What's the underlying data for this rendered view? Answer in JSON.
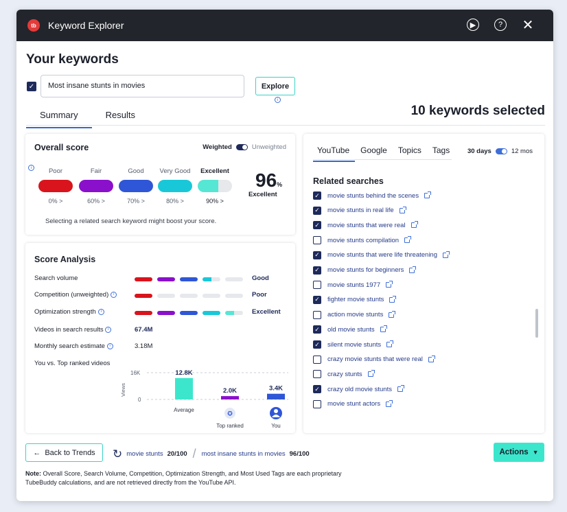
{
  "window": {
    "title": "Keyword Explorer",
    "logo_text": "tb"
  },
  "heading": "Your keywords",
  "keyword_input": {
    "value": "Most insane stunts in movies",
    "checked": true
  },
  "explore_label": "Explore",
  "tabs": [
    {
      "label": "Summary",
      "active": true
    },
    {
      "label": "Results",
      "active": false
    }
  ],
  "keywords_selected": "10 keywords selected",
  "overall": {
    "title": "Overall score",
    "toggle_left": "Weighted",
    "toggle_right": "Unweighted",
    "levels": [
      {
        "label": "Poor",
        "sub": "0% >",
        "color": "#d9141c",
        "fill": 1.0
      },
      {
        "label": "Fair",
        "sub": "60% >",
        "color": "#8a10cc",
        "fill": 1.0
      },
      {
        "label": "Good",
        "sub": "70% >",
        "color": "#2f56d6",
        "fill": 1.0
      },
      {
        "label": "Very Good",
        "sub": "80% >",
        "color": "#18c8d8",
        "fill": 1.0
      },
      {
        "label": "Excellent",
        "sub": "90% >",
        "color": "#56e6d4",
        "fill": 0.6
      }
    ],
    "score": "96",
    "score_unit": "%",
    "score_label": "Excellent",
    "note": "Selecting a related search keyword might boost your score."
  },
  "analysis": {
    "title": "Score Analysis",
    "rows": [
      {
        "label": "Search volume",
        "value": "Good",
        "segments": [
          1,
          1,
          1,
          0.5,
          0
        ]
      },
      {
        "label": "Competition (unweighted)",
        "value": "Poor",
        "segments": [
          1,
          0,
          0,
          0,
          0
        ]
      },
      {
        "label": "Optimization strength",
        "value": "Excellent",
        "segments": [
          1,
          1,
          1,
          1,
          0.5
        ]
      }
    ],
    "videos_label": "Videos in search results",
    "videos_value": "67.4M",
    "monthly_label": "Monthly search estimate",
    "monthly_value": "3.18M",
    "vs_label": "You vs. Top ranked videos",
    "chart": {
      "ylabel": "Views",
      "ymax_label": "16K",
      "ymin_label": "0",
      "bars": [
        {
          "name": "Average",
          "value_label": "12.8K",
          "value": 12800,
          "color": "#3ce6cd"
        },
        {
          "name": "Top ranked",
          "value_label": "2.0K",
          "value": 2000,
          "color": "#8a10cc"
        },
        {
          "name": "You",
          "value_label": "3.4K",
          "value": 3400,
          "color": "#2f56d6"
        }
      ],
      "ymax": 16000
    }
  },
  "right": {
    "tabs": [
      {
        "label": "YouTube",
        "active": true
      },
      {
        "label": "Google"
      },
      {
        "label": "Topics"
      },
      {
        "label": "Tags"
      }
    ],
    "range_left": "30 days",
    "range_right": "12 mos",
    "related_title": "Related searches",
    "items": [
      {
        "text": "movie stunts behind the scenes",
        "checked": true
      },
      {
        "text": "movie stunts in real life",
        "checked": true
      },
      {
        "text": "movie stunts that were real",
        "checked": true
      },
      {
        "text": "movie stunts compilation",
        "checked": false
      },
      {
        "text": "movie stunts that were life threatening",
        "checked": true
      },
      {
        "text": "movie stunts for beginners",
        "checked": true
      },
      {
        "text": "movie stunts 1977",
        "checked": false
      },
      {
        "text": "fighter movie stunts",
        "checked": true
      },
      {
        "text": "action movie stunts",
        "checked": false
      },
      {
        "text": "old movie stunts",
        "checked": true
      },
      {
        "text": "silent movie stunts",
        "checked": true
      },
      {
        "text": "crazy movie stunts that were real",
        "checked": false
      },
      {
        "text": "crazy stunts",
        "checked": false
      },
      {
        "text": "crazy old movie stunts",
        "checked": true
      },
      {
        "text": "movie stunt actors",
        "checked": false
      }
    ]
  },
  "footer": {
    "back_label": "Back to Trends",
    "quota1_kw": "movie stunts",
    "quota1_count": "20/100",
    "quota2_kw": "most insane stunts in movies",
    "quota2_count": "96/100",
    "actions_label": "Actions",
    "note_bold": "Note:",
    "note_text": "Overall Score, Search Volume, Competition, Optimization Strength, and Most Used Tags are each proprietary TubeBuddy calculations, and are not retrieved directly from the YouTube API."
  }
}
